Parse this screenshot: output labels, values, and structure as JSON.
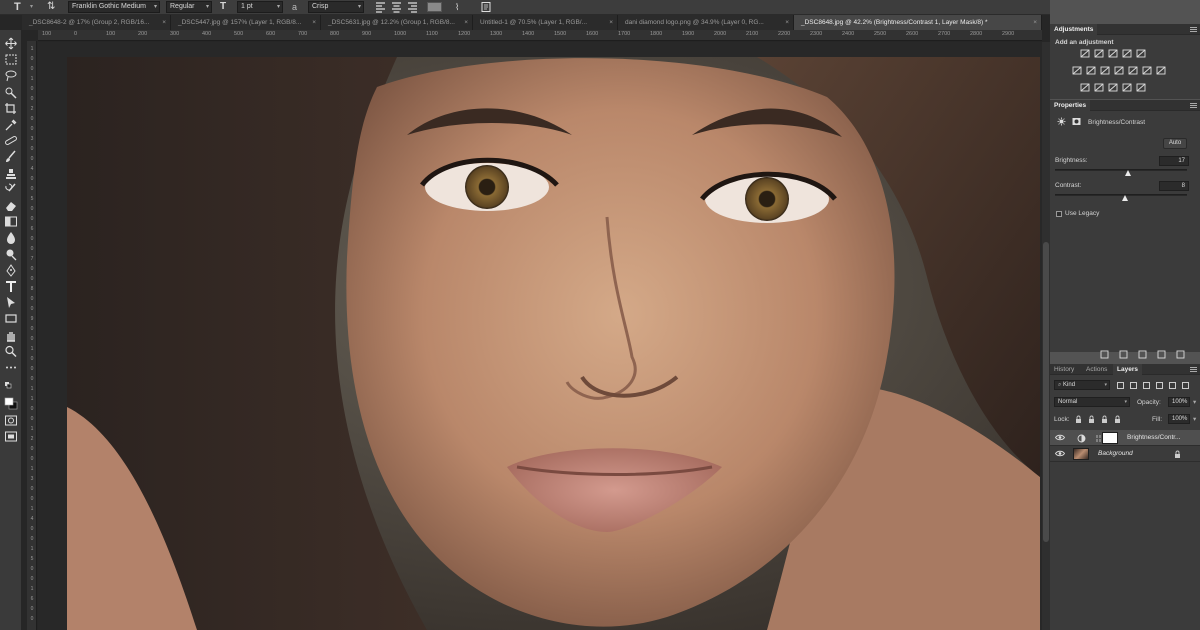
{
  "options_bar": {
    "font_family": "Franklin Gothic Medium",
    "font_style": "Regular",
    "font_size": "1 pt",
    "anti_alias": "Crisp",
    "tool_icon": "type-tool-icon",
    "orientation_icon": "text-orientation-icon",
    "size_icon": "font-size-icon",
    "warp_icon": "warp-text-icon",
    "panels_icon": "character-panel-icon",
    "search_icon": "search-icon",
    "workspace_icon": "workspace-icon"
  },
  "tabs": [
    {
      "label": "_DSC8648-2 @ 17% (Group 2, RGB/16...",
      "close": "×"
    },
    {
      "label": "_DSC5447.jpg @ 157% (Layer 1, RGB/8...",
      "close": "×"
    },
    {
      "label": "_DSC5631.jpg @ 12.2% (Group 1, RGB/8...",
      "close": "×"
    },
    {
      "label": "Untitled-1 @ 70.5% (Layer 1, RGB/...",
      "close": "×"
    },
    {
      "label": "dani diamond logo.png @ 34.9% (Layer 0, RG...",
      "close": "×"
    },
    {
      "label": "_DSC8648.jpg @ 42.2% (Brightness/Contrast 1, Layer Mask/8) *",
      "close": "×"
    }
  ],
  "ruler": {
    "top_ticks": [
      "100",
      "0",
      "100",
      "200",
      "300",
      "400",
      "500",
      "600",
      "700",
      "800",
      "900",
      "1000",
      "1100",
      "1200",
      "1300",
      "1400",
      "1500",
      "1600",
      "1700",
      "1800",
      "1900",
      "2000",
      "2100",
      "2200",
      "2300",
      "2400",
      "2500",
      "2600",
      "2700",
      "2800",
      "2900"
    ],
    "left_ticks": [
      "1",
      "0",
      "0",
      "1",
      "0",
      "0",
      "2",
      "0",
      "0",
      "3",
      "0",
      "0",
      "4",
      "0",
      "0",
      "5",
      "0",
      "0",
      "6",
      "0",
      "0",
      "7",
      "0",
      "0",
      "8",
      "0",
      "0",
      "9",
      "0",
      "0",
      "1",
      "0",
      "0",
      "0",
      "1",
      "1",
      "0",
      "0",
      "1",
      "2",
      "0",
      "0",
      "1",
      "3",
      "0",
      "0",
      "1",
      "4",
      "0",
      "0",
      "1",
      "5",
      "0",
      "0",
      "1",
      "6",
      "0",
      "0"
    ]
  },
  "toolbar": {
    "tools": [
      "move-tool-icon",
      "marquee-tool-icon",
      "lasso-tool-icon",
      "quick-select-tool-icon",
      "crop-tool-icon",
      "eyedropper-tool-icon",
      "healing-brush-tool-icon",
      "brush-tool-icon",
      "clone-stamp-tool-icon",
      "history-brush-tool-icon",
      "eraser-tool-icon",
      "gradient-tool-icon",
      "blur-tool-icon",
      "dodge-tool-icon",
      "pen-tool-icon",
      "type-tool-icon",
      "path-select-tool-icon",
      "rectangle-tool-icon",
      "hand-tool-icon",
      "zoom-tool-icon",
      "more-tools-icon",
      "default-colors-icon",
      "color-swatches-icon",
      "quick-mask-icon",
      "screen-mode-icon"
    ]
  },
  "adjustments": {
    "tab": "Adjustments",
    "subtitle": "Add an adjustment",
    "icons_row1": [
      "brightness-contrast-icon",
      "levels-icon",
      "curves-icon",
      "exposure-icon",
      "gradient-triangle-icon"
    ],
    "icons_row2": [
      "vibrance-icon",
      "hue-saturation-icon",
      "color-balance-icon",
      "black-white-icon",
      "photo-filter-icon",
      "channel-mixer-icon",
      "color-lookup-icon"
    ],
    "icons_row3": [
      "invert-icon",
      "posterize-icon",
      "threshold-icon",
      "selective-color-icon",
      "gradient-map-icon"
    ]
  },
  "properties": {
    "tab": "Properties",
    "title": "Brightness/Contrast",
    "auto_label": "Auto",
    "brightness_label": "Brightness:",
    "brightness_value": "17",
    "contrast_label": "Contrast:",
    "contrast_value": "8",
    "legacy_label": "Use Legacy",
    "brightness_fraction": 0.55,
    "contrast_fraction": 0.53,
    "footer_icons": [
      "clip-to-layer-icon",
      "view-previous-icon",
      "reset-icon",
      "visibility-icon",
      "delete-icon"
    ]
  },
  "layers_panel": {
    "tabs": [
      "History",
      "Actions",
      "Layers"
    ],
    "active_tab": "Layers",
    "kind_label": "Kind",
    "filter_icons": [
      "pixel-filter-icon",
      "adjustment-filter-icon",
      "type-filter-icon",
      "shape-filter-icon",
      "smart-object-filter-icon",
      "filter-toggle-icon"
    ],
    "blend_mode": "Normal",
    "opacity_label": "Opacity:",
    "opacity_value": "100%",
    "lock_label": "Lock:",
    "lock_icons": [
      "lock-pixels-icon",
      "lock-position-icon",
      "lock-artboard-icon",
      "lock-all-icon"
    ],
    "fill_label": "Fill:",
    "fill_value": "100%",
    "layers": [
      {
        "name": "Brightness/Contr...",
        "selected": true,
        "type": "adjustment"
      },
      {
        "name": "Background",
        "selected": false,
        "type": "image",
        "locked": true
      }
    ]
  },
  "colors": {
    "accent": "#2d8ceb",
    "panel_bg": "#3b3b3b",
    "canvas_bg": "#282828"
  }
}
